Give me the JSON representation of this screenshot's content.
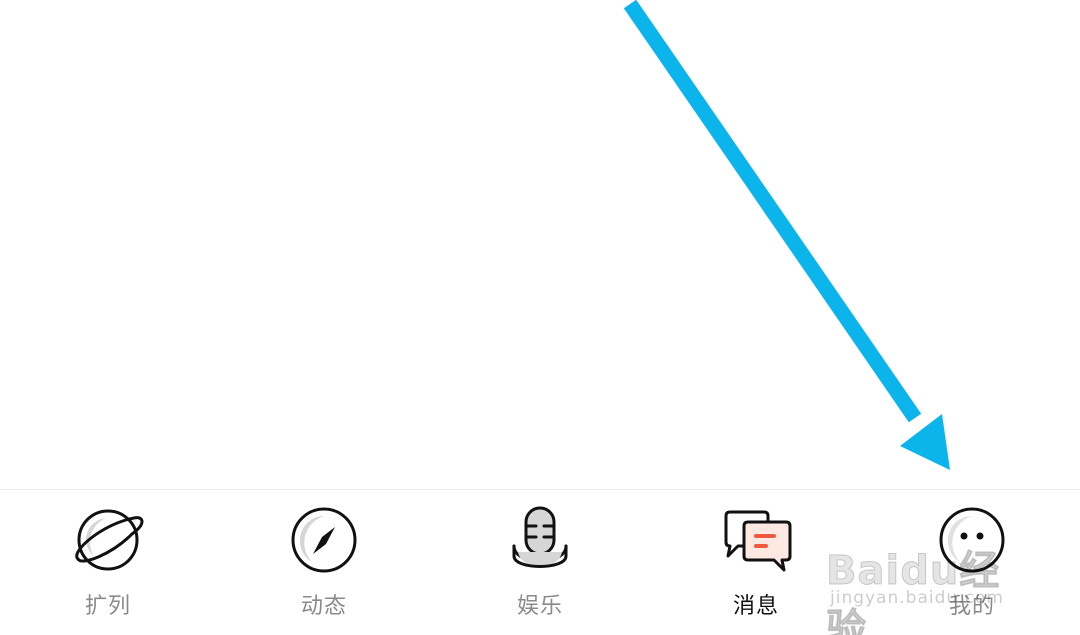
{
  "tabbar": {
    "items": [
      {
        "label": "扩列",
        "icon": "planet-icon",
        "active": false
      },
      {
        "label": "动态",
        "icon": "compass-icon",
        "active": false
      },
      {
        "label": "娱乐",
        "icon": "microphone-icon",
        "active": false
      },
      {
        "label": "消息",
        "icon": "chat-bubbles-icon",
        "active": true
      },
      {
        "label": "我的",
        "icon": "face-icon",
        "active": false
      }
    ]
  },
  "watermark": {
    "logo": "Baidu经验",
    "url": "jingyan.baidu.com"
  },
  "colors": {
    "arrow": "#0bb4ea",
    "active_label": "#111111",
    "inactive_label": "#8a8a8a",
    "message_accent": "#f05a3c"
  }
}
